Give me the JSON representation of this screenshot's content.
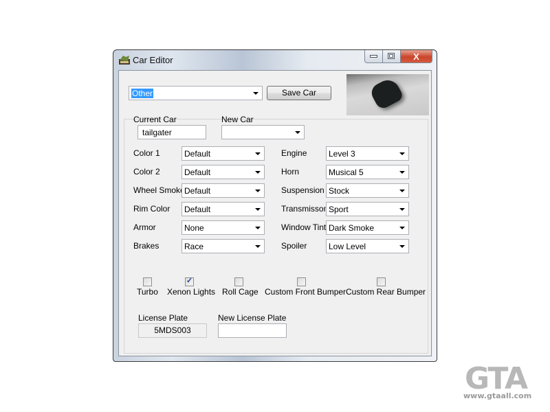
{
  "window": {
    "title": "Car Editor",
    "icon": "car-editor-app-icon",
    "controls": {
      "minimize": "minimize-icon",
      "maximize": "maximize-icon",
      "close": "close-icon",
      "close_glyph": "X"
    }
  },
  "top": {
    "car_select": {
      "value": "Other",
      "selected": true
    },
    "save_button": "Save Car",
    "preview": "car-preview-image"
  },
  "car": {
    "current_label": "Current Car",
    "current_value": "tailgater",
    "new_label": "New Car",
    "new_value": ""
  },
  "options_left": [
    {
      "label": "Color 1",
      "value": "Default"
    },
    {
      "label": "Color 2",
      "value": "Default"
    },
    {
      "label": "Wheel Smoke",
      "value": "Default"
    },
    {
      "label": "Rim Color",
      "value": "Default"
    },
    {
      "label": "Armor",
      "value": "None"
    },
    {
      "label": "Brakes",
      "value": "Race"
    }
  ],
  "options_right": [
    {
      "label": "Engine",
      "value": "Level 3"
    },
    {
      "label": "Horn",
      "value": "Musical 5"
    },
    {
      "label": "Suspension",
      "value": "Stock"
    },
    {
      "label": "Transmisson",
      "value": "Sport"
    },
    {
      "label": "Window Tint",
      "value": "Dark Smoke"
    },
    {
      "label": "Spoiler",
      "value": "Low Level"
    }
  ],
  "checkboxes": [
    {
      "label": "Turbo",
      "checked": false
    },
    {
      "label": "Xenon Lights",
      "checked": true
    },
    {
      "label": "Roll Cage",
      "checked": false
    },
    {
      "label": "Custom Front Bumper",
      "checked": false
    },
    {
      "label": "Custom Rear Bumper",
      "checked": false
    }
  ],
  "check_glyph": "✓",
  "plate": {
    "current_label": "License Plate",
    "current_value": "5MDS003",
    "new_label": "New License Plate",
    "new_value": ""
  },
  "watermark": {
    "letters": "GTA",
    "url": "www.gtaall.com"
  }
}
